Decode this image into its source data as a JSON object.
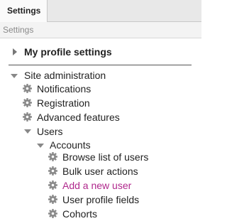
{
  "tab": {
    "label": "Settings"
  },
  "header": {
    "title": "Settings"
  },
  "tree": {
    "profile": {
      "label": "My profile settings"
    },
    "site_admin": {
      "label": "Site administration",
      "items": [
        {
          "label": "Notifications",
          "icon": "gear-icon"
        },
        {
          "label": "Registration",
          "icon": "gear-icon"
        },
        {
          "label": "Advanced features",
          "icon": "gear-icon"
        }
      ],
      "users": {
        "label": "Users",
        "accounts": {
          "label": "Accounts",
          "items": [
            {
              "label": "Browse list of users",
              "icon": "gear-icon"
            },
            {
              "label": "Bulk user actions",
              "icon": "gear-icon"
            },
            {
              "label": "Add a new user",
              "icon": "gear-icon",
              "active": true
            },
            {
              "label": "User profile fields",
              "icon": "gear-icon"
            },
            {
              "label": "Cohorts",
              "icon": "gear-icon"
            }
          ]
        }
      }
    }
  },
  "colors": {
    "active_link": "#b0288c",
    "gear": "#8a8a8a"
  }
}
